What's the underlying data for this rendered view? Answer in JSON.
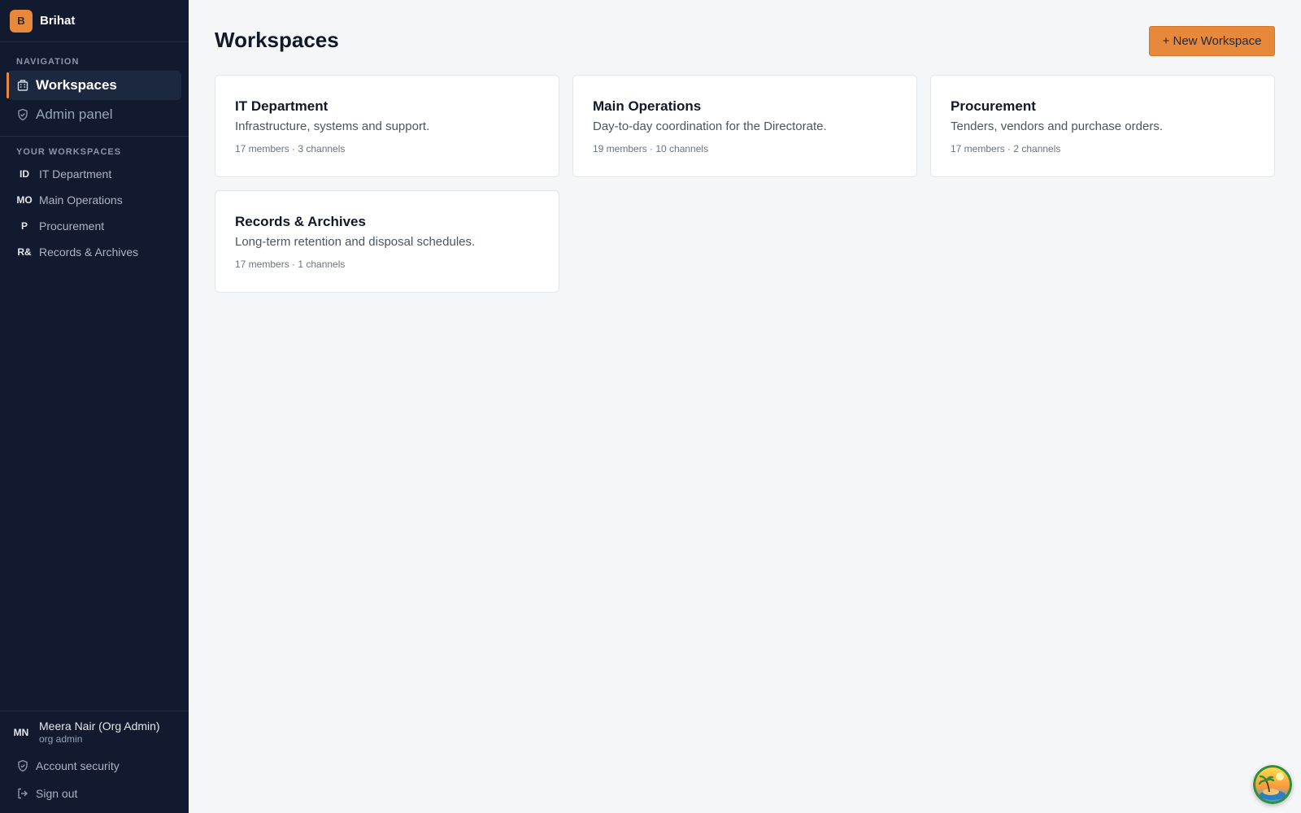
{
  "brand": {
    "initial": "B",
    "name": "Brihat"
  },
  "sidebar": {
    "nav_label": "NAVIGATION",
    "nav": [
      {
        "label": "Workspaces",
        "icon": "building-icon",
        "active": true
      },
      {
        "label": "Admin panel",
        "icon": "shield-icon",
        "active": false
      }
    ],
    "workspaces_label": "YOUR WORKSPACES",
    "workspaces": [
      {
        "abbr": "ID",
        "label": "IT Department"
      },
      {
        "abbr": "MO",
        "label": "Main Operations"
      },
      {
        "abbr": "P",
        "label": "Procurement"
      },
      {
        "abbr": "R&",
        "label": "Records & Archives"
      }
    ],
    "user": {
      "initials": "MN",
      "name": "Meera Nair (Org Admin)",
      "role": "org admin"
    },
    "footer": [
      {
        "label": "Account security",
        "icon": "shield-icon"
      },
      {
        "label": "Sign out",
        "icon": "sign-out-icon"
      }
    ]
  },
  "main": {
    "title": "Workspaces",
    "new_button": "+ New Workspace",
    "cards": [
      {
        "title": "IT Department",
        "description": "Infrastructure, systems and support.",
        "meta": "17 members · 3 channels"
      },
      {
        "title": "Main Operations",
        "description": "Day-to-day coordination for the Directorate.",
        "meta": "19 members · 10 channels"
      },
      {
        "title": "Procurement",
        "description": "Tenders, vendors and purchase orders.",
        "meta": "17 members · 2 channels"
      },
      {
        "title": "Records & Archives",
        "description": "Long-term retention and disposal schedules.",
        "meta": "17 members · 1 channels"
      }
    ]
  },
  "colors": {
    "accent": "#e8883a",
    "sidebar_bg": "#111a2e",
    "page_bg": "#f4f6f8"
  }
}
